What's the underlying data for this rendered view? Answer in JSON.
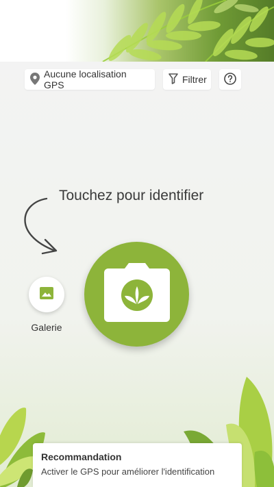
{
  "toolbar": {
    "gps_label": "Aucune localisation GPS",
    "filter_label": "Filtrer"
  },
  "main": {
    "prompt": "Touchez pour identifier",
    "gallery_label": "Galerie"
  },
  "recommendation": {
    "title": "Recommandation",
    "text": "Activer le GPS pour améliorer l'identification"
  },
  "icons": {
    "location": "location-pin-icon",
    "filter": "filter-icon",
    "help": "help-icon",
    "gallery": "image-icon",
    "camera": "camera-icon",
    "leaf": "leaf-icon"
  },
  "colors": {
    "accent": "#8db43a",
    "background": "#f2f2f2"
  }
}
